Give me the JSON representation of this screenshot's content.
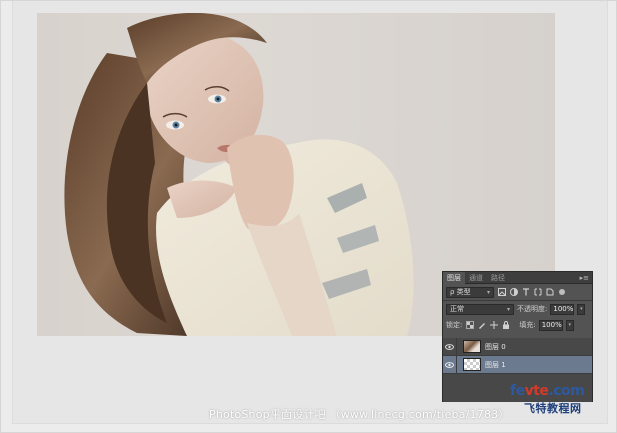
{
  "layers_panel": {
    "tabs": [
      {
        "label": "图层",
        "active": true
      },
      {
        "label": "通道",
        "active": false
      },
      {
        "label": "路径",
        "active": false
      }
    ],
    "menu_glyph": "▸≡",
    "filter": {
      "icon": "search-icon",
      "label": "ρ 类型",
      "arrow": "▾"
    },
    "filter_icons": [
      "image-filter-icon",
      "adjustment-filter-icon",
      "type-filter-icon",
      "shape-filter-icon",
      "smartobject-filter-icon"
    ],
    "blend_mode": {
      "value": "正常",
      "arrow": "▾"
    },
    "opacity": {
      "label": "不透明度:",
      "value": "100%"
    },
    "lock": {
      "label": "锁定:"
    },
    "fill": {
      "label": "填充:",
      "value": "100%"
    },
    "layers": [
      {
        "name": "图层 0",
        "visible": true,
        "selected": false,
        "thumb": "photo"
      },
      {
        "name": "图层 1",
        "visible": true,
        "selected": true,
        "thumb": "transparent"
      }
    ]
  },
  "watermark": {
    "text": "PhotoShop平面设计吧 （www.linecg.com/tieba/1783）"
  },
  "logo": {
    "line1_a": "fe",
    "line1_b": "vte",
    "line1_c": ".com",
    "line2": "飞特教程网"
  },
  "colors": {
    "panel_bg": "#535353",
    "selected_layer": "#6b7a8f",
    "logo_blue": "#2c5aa0",
    "logo_red": "#d23b2b"
  }
}
